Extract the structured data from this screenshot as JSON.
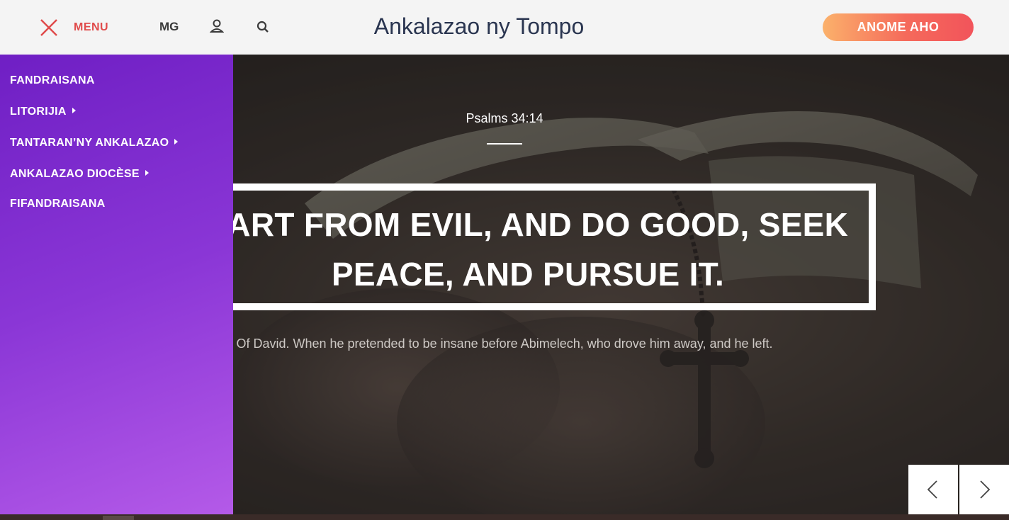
{
  "header": {
    "menu_label": "MENU",
    "language": "MG",
    "site_title": "Ankalazao ny Tompo",
    "cta_label": "ANOME AHO",
    "icons": [
      "close-icon",
      "user-icon",
      "search-icon"
    ]
  },
  "sidebar": {
    "items": [
      {
        "label": "FANDRAISANA",
        "has_submenu": false
      },
      {
        "label": "LITORIJIA",
        "has_submenu": true
      },
      {
        "label": "TANTARAN’NY ANKALAZAO",
        "has_submenu": true
      },
      {
        "label": "ANKALAZAO DIOCÈSE",
        "has_submenu": true
      },
      {
        "label": "FIFANDRAISANA",
        "has_submenu": false
      }
    ]
  },
  "hero": {
    "reference": "Psalms 34:14",
    "quote_line1": "PART FROM EVIL, AND DO GOOD, SEEK",
    "quote_line2": "PEACE, AND PURSUE IT.",
    "subtitle": "Of David. When he pretended to be insane before Abimelech, who drove him away, and he left."
  },
  "slider": {
    "prev_icon": "chevron-left-icon",
    "next_icon": "chevron-right-icon"
  },
  "colors": {
    "accent": "#e04b4b",
    "sidebar_top": "#6f1fc4",
    "sidebar_bottom": "#b45ae8",
    "cta_start": "#fbb16b",
    "cta_end": "#f2545b",
    "title": "#2a3550"
  }
}
